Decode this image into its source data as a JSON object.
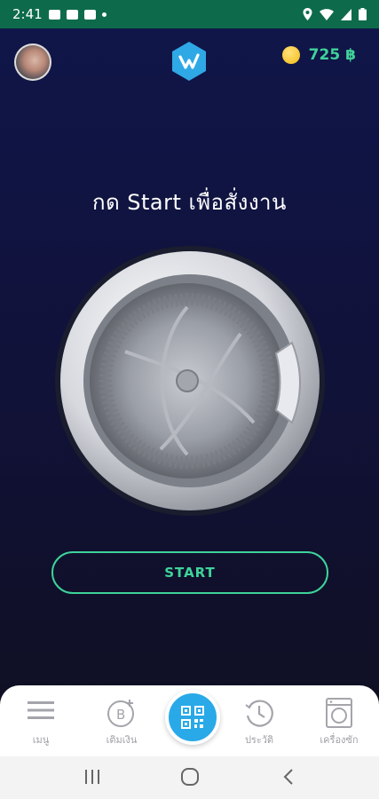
{
  "status_bar": {
    "time": "2:41"
  },
  "header": {
    "coins": "725",
    "currency": "฿"
  },
  "main": {
    "instruction": "กด Start เพื่อสั่งงาน",
    "start_label": "START"
  },
  "bottom_nav": {
    "items": [
      {
        "label": "เมนู",
        "icon": "hamburger-menu-icon"
      },
      {
        "label": "เติมเงิน",
        "icon": "baht-plus-icon"
      },
      {
        "label": "",
        "icon": "qr-code-icon"
      },
      {
        "label": "ประวัติ",
        "icon": "history-clock-icon"
      },
      {
        "label": "เครื่องซัก",
        "icon": "washing-machine-icon"
      }
    ]
  },
  "colors": {
    "accent": "#3fd39a",
    "status_bar": "#0d6b4c",
    "fab": "#29a9e8",
    "background_top": "#10164a",
    "background_bottom": "#0f0f1e"
  }
}
